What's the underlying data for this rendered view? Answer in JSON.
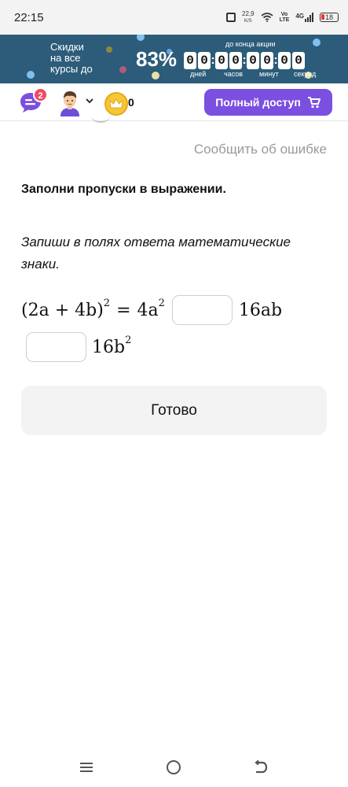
{
  "status_bar": {
    "time": "22:15",
    "net_speed_value": "22,9",
    "net_speed_unit": "K/S",
    "volte_top": "Vo",
    "volte_bottom": "LTE",
    "network": "4G",
    "battery": "18"
  },
  "promo": {
    "text_line1": "Скидки",
    "text_line2": "на все",
    "text_line3": "курсы до",
    "percent": "83%",
    "until_label": "до конца акции",
    "timer": {
      "days": [
        "0",
        "0"
      ],
      "hours": [
        "0",
        "0"
      ],
      "minutes": [
        "0",
        "0"
      ],
      "seconds": [
        "0",
        "0"
      ],
      "days_label": "дней",
      "hours_label": "часов",
      "minutes_label": "минут",
      "seconds_label": "секунд"
    },
    "colors": {
      "background": "#2c5c7a"
    }
  },
  "header": {
    "chat_badge": "2",
    "coin_count": "0",
    "access_button": "Полный доступ",
    "colors": {
      "accent": "#7b4fe0",
      "badge": "#ef4b63",
      "coin": "#f6c636"
    },
    "icons": [
      "chat-icon",
      "avatar",
      "chevron-down-icon",
      "crown-coin-icon",
      "cart-icon"
    ]
  },
  "content": {
    "report_link": "Сообщить об ошибке",
    "task_title": "Заполни пропуски в выражении.",
    "task_hint": "Запиши в полях ответа математические знаки.",
    "expression": {
      "lhs": "(2a + 4b)",
      "lhs_exp": "2",
      "equals": "=",
      "term1": "4a",
      "term1_exp": "2",
      "term2": "16ab",
      "term3": "16b",
      "term3_exp": "2"
    },
    "answer_1_value": "",
    "answer_2_value": "",
    "done_button": "Готово"
  },
  "nav_bar": {
    "icons": [
      "menu-icon",
      "home-icon",
      "back-icon"
    ]
  }
}
